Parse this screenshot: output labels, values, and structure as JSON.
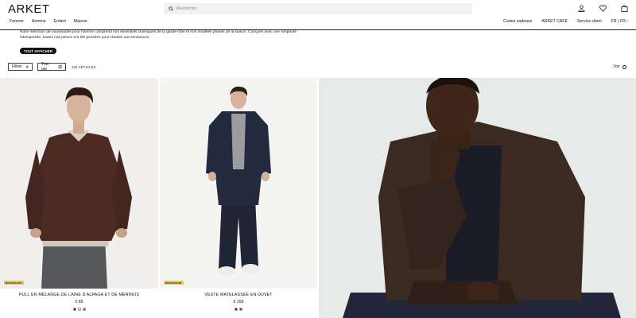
{
  "header": {
    "logo": "ARKET",
    "nav": [
      "Femme",
      "Homme",
      "Enfant",
      "Maison"
    ],
    "search_placeholder": "Rechercher",
    "util_links": [
      "Cartes cadeaux",
      "ARKET CAFÉ",
      "Service client",
      "FR | FR ›"
    ],
    "icons": [
      "account-icon",
      "heart-icon",
      "bag-icon"
    ]
  },
  "intro": {
    "text": "Notre sélection de nouveautés pour homme comprend nos essentiels classiques de la garde-robe et nos modèles phares de la saison. Conçues avec une simplicité intemporelle, toutes nos pièces ont été pensées pour résister aux tendances.",
    "button": "TOUT AFFICHER"
  },
  "toolbar": {
    "filter": "Filtrer",
    "sort": "Trier par",
    "count": "150 ARTICLES",
    "view": "Voir"
  },
  "products": [
    {
      "badge": "NOUVEAUTÉ",
      "name": "PULL EN MÉLANGE DE LAINE D'ALPAGA ET DE MÉRINOS",
      "price": "€ 89",
      "swatches": [
        "#3a2420",
        "#d9cfbf",
        "#b0553a"
      ]
    },
    {
      "badge": "NOUVEAUTÉ",
      "name": "VESTE MATELASSÉE EN DUVET",
      "price": "€ 159",
      "swatches": [
        "#1e2436",
        "#55524d"
      ]
    }
  ],
  "colors": {
    "accent": "#111111",
    "badge": "#e9c94a",
    "search_bg": "#f1f1f1"
  }
}
